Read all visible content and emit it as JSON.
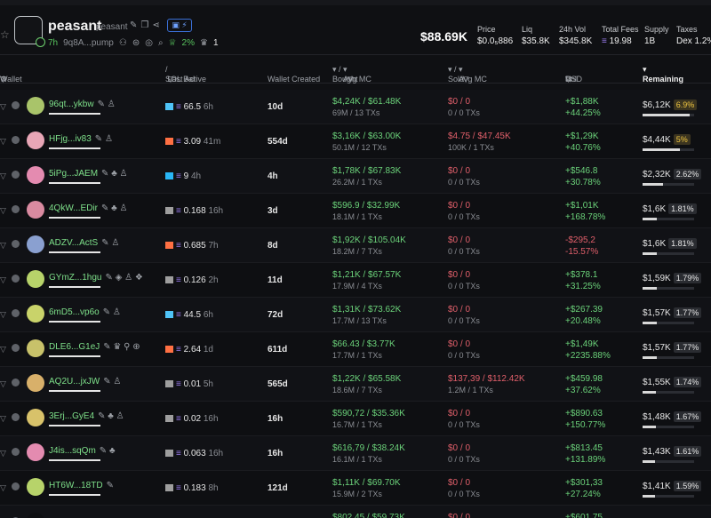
{
  "token": {
    "name": "peasant",
    "subname": "peasant",
    "age": "7h",
    "address": "9q8A...pump",
    "holders_pct": "2%",
    "count": "1",
    "badge": "⚡"
  },
  "stats": {
    "market_cap": "$88.69K",
    "price_label": "Price",
    "price": "$0.0₅886",
    "liq_label": "Liq",
    "liq": "$35.8K",
    "vol_label": "24h Vol",
    "vol": "$345.8K",
    "fees_label": "Total Fees",
    "fees": "19.98",
    "supply_label": "Supply",
    "supply": "1B",
    "taxes_label": "Taxes",
    "taxes": "Dex 1.2%"
  },
  "columns": {
    "wallet": "Wallet",
    "sol_bal": "SOL Bal",
    "last_active": "Last Active",
    "wallet_created": "Wallet Created",
    "bought": "Bought",
    "avg_mc_b": "Avg MC",
    "sold": "Sold",
    "avg_mc_s": "Avg MC",
    "pnl": "Pnl",
    "usd": "USD",
    "remaining": "Remaining"
  },
  "rows": [
    {
      "wallet": "96qt...ykbw",
      "tags": "✎ ♙",
      "pfp": "#a9c46a",
      "sol": "66.5",
      "ago": "6h",
      "sicon": "#4fc3f7",
      "created": "10d",
      "b1": "$4,24K / $61.48K",
      "b2": "69M / 13 TXs",
      "s1": "$0 / 0",
      "s2": "0 / 0 TXs",
      "p1": "+$1,88K",
      "p2": "+44.25%",
      "pn": true,
      "r": "$6,12K",
      "rp": "6.9%",
      "hl": true,
      "fill": 0.92
    },
    {
      "wallet": "HFjg...iv83",
      "tags": "✎ ♙",
      "pfp": "#e8a6b6",
      "sol": "3.09",
      "ago": "41m",
      "sicon": "#ff7043",
      "created": "554d",
      "b1": "$3,16K / $63.00K",
      "b2": "50.1M / 12 TXs",
      "s1": "$4.75 / $47.45K",
      "s2": "100K / 1 TXs",
      "p1": "+$1,29K",
      "p2": "+40.76%",
      "pn": true,
      "r": "$4,44K",
      "rp": "5%",
      "hl": true,
      "fill": 0.72
    },
    {
      "wallet": "5iPg...JAEM",
      "tags": "✎ ♣ ♙",
      "pfp": "#e48bb0",
      "sol": "9",
      "ago": "4h",
      "sicon": "#29b6f6",
      "created": "4h",
      "b1": "$1,78K / $67.83K",
      "b2": "26.2M / 1 TXs",
      "s1": "$0 / 0",
      "s2": "0 / 0 TXs",
      "p1": "+$546.8",
      "p2": "+30.78%",
      "pn": true,
      "r": "$2,32K",
      "rp": "2.62%",
      "hl": false,
      "fill": 0.4
    },
    {
      "wallet": "4QkW...EDir",
      "tags": "✎ ♣ ♙",
      "pfp": "#d98aa0",
      "sol": "0.168",
      "ago": "16h",
      "sicon": "#9e9e9e",
      "created": "3d",
      "b1": "$596.9 / $32.99K",
      "b2": "18.1M / 1 TXs",
      "s1": "$0 / 0",
      "s2": "0 / 0 TXs",
      "p1": "+$1,01K",
      "p2": "+168.78%",
      "pn": true,
      "r": "$1,6K",
      "rp": "1.81%",
      "hl": false,
      "fill": 0.28
    },
    {
      "wallet": "ADZV...ActS",
      "tags": "✎ ♙",
      "pfp": "#8aa0d0",
      "sol": "0.685",
      "ago": "7h",
      "sicon": "#ff7043",
      "created": "8d",
      "b1": "$1,92K / $105.04K",
      "b2": "18.2M / 7 TXs",
      "s1": "$0 / 0",
      "s2": "0 / 0 TXs",
      "p1": "-$295,2",
      "p2": "-15.57%",
      "pn": false,
      "r": "$1,6K",
      "rp": "1.81%",
      "hl": false,
      "fill": 0.28
    },
    {
      "wallet": "GYmZ...1hgu",
      "tags": "✎ ◈ ♙ ❖",
      "pfp": "#b7d36a",
      "sol": "0.126",
      "ago": "2h",
      "sicon": "#9e9e9e",
      "created": "11d",
      "b1": "$1,21K / $67.57K",
      "b2": "17.9M / 4 TXs",
      "s1": "$0 / 0",
      "s2": "0 / 0 TXs",
      "p1": "+$378.1",
      "p2": "+31.25%",
      "pn": true,
      "r": "$1,59K",
      "rp": "1.79%",
      "hl": false,
      "fill": 0.27
    },
    {
      "wallet": "6mD5...vp6o",
      "tags": "✎ ♙",
      "pfp": "#c9d36a",
      "sol": "44.5",
      "ago": "6h",
      "sicon": "#4fc3f7",
      "created": "72d",
      "b1": "$1,31K / $73.62K",
      "b2": "17.7M / 13 TXs",
      "s1": "$0 / 0",
      "s2": "0 / 0 TXs",
      "p1": "+$267.39",
      "p2": "+20.48%",
      "pn": true,
      "r": "$1,57K",
      "rp": "1.77%",
      "hl": false,
      "fill": 0.27
    },
    {
      "wallet": "DLE6...G1eJ",
      "tags": "✎ ♛ ⚲ ⊕",
      "pfp": "#c8c26a",
      "sol": "2.64",
      "ago": "1d",
      "sicon": "#ff7043",
      "created": "611d",
      "b1": "$66.43 / $3.77K",
      "b2": "17.7M / 1 TXs",
      "s1": "$0 / 0",
      "s2": "0 / 0 TXs",
      "p1": "+$1,49K",
      "p2": "+2235.88%",
      "pn": true,
      "r": "$1,57K",
      "rp": "1.77%",
      "hl": false,
      "fill": 0.27
    },
    {
      "wallet": "AQ2U...jxJW",
      "tags": "✎ ♙",
      "pfp": "#d8b06a",
      "sol": "0.01",
      "ago": "5h",
      "sicon": "#9e9e9e",
      "created": "565d",
      "b1": "$1,22K / $65.58K",
      "b2": "18.6M / 7 TXs",
      "s1": "$137,39 / $112.42K",
      "s2": "1.2M / 1 TXs",
      "p1": "+$459.98",
      "p2": "+37.62%",
      "pn": true,
      "r": "$1,55K",
      "rp": "1.74%",
      "hl": false,
      "fill": 0.26
    },
    {
      "wallet": "3Erj...GyE4",
      "tags": "✎ ♣ ♙",
      "pfp": "#d8c26a",
      "sol": "0.02",
      "ago": "16h",
      "sicon": "#9e9e9e",
      "created": "16h",
      "b1": "$590,72 / $35.36K",
      "b2": "16.7M / 1 TXs",
      "s1": "$0 / 0",
      "s2": "0 / 0 TXs",
      "p1": "+$890.63",
      "p2": "+150.77%",
      "pn": true,
      "r": "$1,48K",
      "rp": "1.67%",
      "hl": false,
      "fill": 0.25
    },
    {
      "wallet": "J4is...sqQm",
      "tags": "✎ ♣",
      "pfp": "#e48bb0",
      "sol": "0.063",
      "ago": "16h",
      "sicon": "#9e9e9e",
      "created": "16h",
      "b1": "$616,79 / $38.24K",
      "b2": "16.1M / 1 TXs",
      "s1": "$0 / 0",
      "s2": "0 / 0 TXs",
      "p1": "+$813.45",
      "p2": "+131.89%",
      "pn": true,
      "r": "$1,43K",
      "rp": "1.61%",
      "hl": false,
      "fill": 0.24
    },
    {
      "wallet": "HT6W...18TD",
      "tags": "✎",
      "pfp": "#b7d36a",
      "sol": "0.183",
      "ago": "8h",
      "sicon": "#9e9e9e",
      "created": "121d",
      "b1": "$1,11K / $69.70K",
      "b2": "15.9M / 2 TXs",
      "s1": "$0 / 0",
      "s2": "0 / 0 TXs",
      "p1": "+$301,33",
      "p2": "+27.24%",
      "pn": true,
      "r": "$1,41K",
      "rp": "1.59%",
      "hl": false,
      "fill": 0.24
    },
    {
      "wallet": "",
      "tags": "",
      "pfp": "#0e0f12",
      "sol": "",
      "ago": "",
      "sicon": "#0e0f12",
      "created": "",
      "b1": "$802.45 / $59.73K",
      "b2": "",
      "s1": "$0 / 0",
      "s2": "",
      "p1": "+$601.75",
      "p2": "",
      "pn": true,
      "r": "",
      "rp": "",
      "hl": false,
      "fill": 0
    }
  ]
}
